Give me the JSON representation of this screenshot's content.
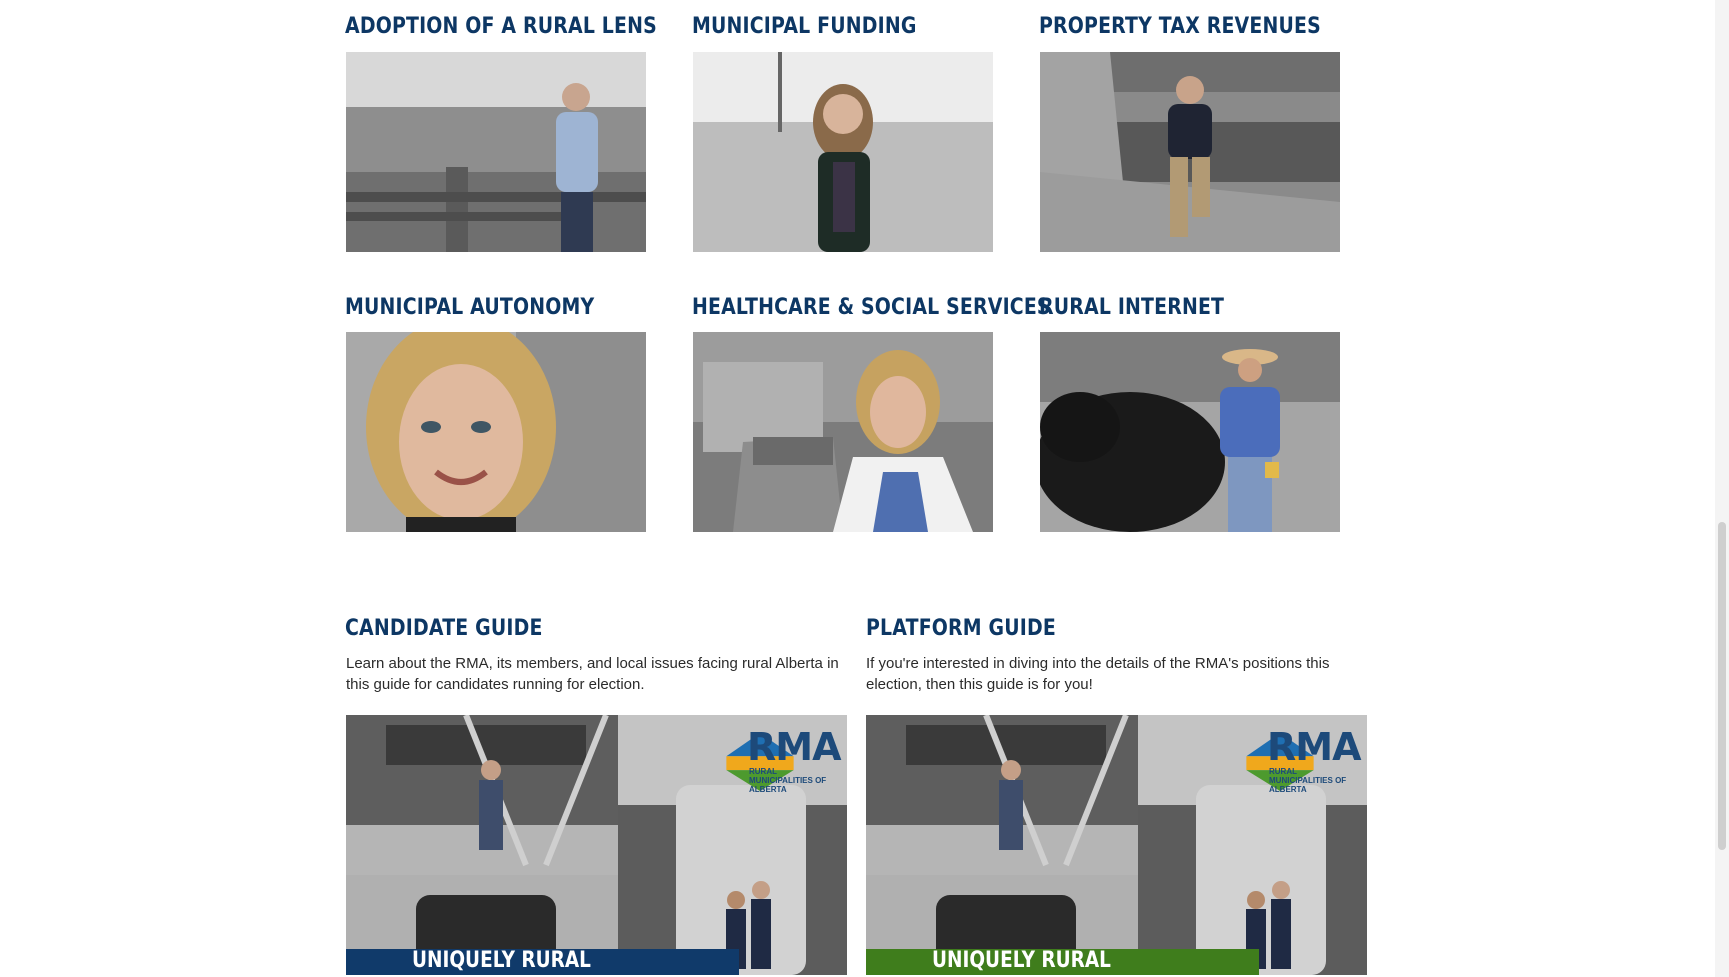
{
  "topics": [
    {
      "title": "ADOPTION OF A RURAL LENS",
      "photo_desc": "person-field-fence"
    },
    {
      "title": "MUNICIPAL FUNDING",
      "photo_desc": "person-grass-field"
    },
    {
      "title": "PROPERTY TAX REVENUES",
      "photo_desc": "person-river-rocks"
    },
    {
      "title": "MUNICIPAL AUTONOMY",
      "photo_desc": "person-selfie"
    },
    {
      "title": "HEALTHCARE & SOCIAL SERVICES",
      "photo_desc": "person-hospital-sign"
    },
    {
      "title": "RURAL INTERNET",
      "photo_desc": "person-with-cattle"
    }
  ],
  "guides": [
    {
      "title": "CANDIDATE GUIDE",
      "description": "Learn about the RMA, its members, and local issues facing rural Alberta in this guide for candidates running for election.",
      "cover_title": "UNIQUELY RURAL",
      "band_color": "#103a6a"
    },
    {
      "title": "PLATFORM GUIDE",
      "description": "If you're interested in diving into the details of the RMA's positions this election, then this guide is for you!",
      "cover_title": "UNIQUELY RURAL",
      "band_color": "#3f7d1c"
    }
  ],
  "logo": {
    "word": "RMA",
    "subtitle": "RURAL MUNICIPALITIES of ALBERTA"
  },
  "colors": {
    "heading": "#0d3764",
    "text": "#2b2b2b"
  }
}
